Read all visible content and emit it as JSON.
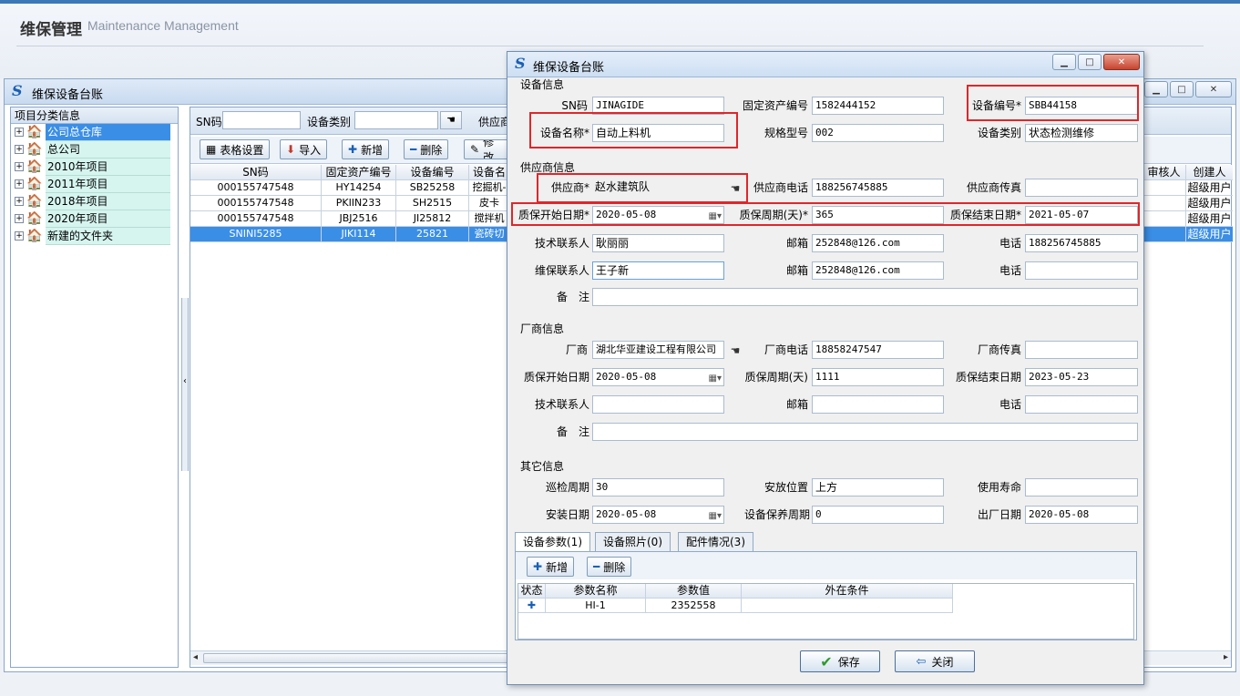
{
  "banner": {
    "title_cn": "维保管理",
    "title_en": "Maintenance Management"
  },
  "main_window": {
    "title": "维保设备台账",
    "tree": {
      "header": "项目分类信息",
      "items": [
        {
          "label": "公司总仓库",
          "selected": true
        },
        {
          "label": "总公司"
        },
        {
          "label": "2010年项目"
        },
        {
          "label": "2011年项目"
        },
        {
          "label": "2018年项目"
        },
        {
          "label": "2020年项目"
        },
        {
          "label": "新建的文件夹"
        }
      ]
    },
    "filter": {
      "sn_label": "SN码",
      "type_label": "设备类别",
      "supplier_label": "供应商"
    },
    "toolbar": {
      "table_settings": "表格设置",
      "import": "导入",
      "add": "新增",
      "delete": "删除",
      "edit": "修改"
    },
    "grid": {
      "headers": [
        "SN码",
        "固定资产编号",
        "设备编号",
        "设备名"
      ],
      "right_headers": [
        "审核人",
        "创建人"
      ],
      "rows": [
        {
          "sn": "000155747548",
          "asset": "HY14254",
          "code": "SB25258",
          "name": "挖掘机-",
          "creator": "超级用户"
        },
        {
          "sn": "000155747548",
          "asset": "PKIIN233",
          "code": "SH2515",
          "name": "皮卡",
          "creator": "超级用户"
        },
        {
          "sn": "000155747548",
          "asset": "JBJ2516",
          "code": "JI25812",
          "name": "搅拌机",
          "creator": "超级用户"
        },
        {
          "sn": "SNINI5285",
          "asset": "JIKI114",
          "code": "25821",
          "name": "瓷砖切",
          "creator": "超级用户",
          "selected": true
        }
      ]
    }
  },
  "dialog": {
    "title": "维保设备台账",
    "sections": {
      "device": "设备信息",
      "supplier": "供应商信息",
      "manufacturer": "厂商信息",
      "other": "其它信息"
    },
    "device": {
      "sn_label": "SN码",
      "sn_value": "JINAGIDE",
      "asset_label": "固定资产编号",
      "asset_value": "1582444152",
      "code_label": "设备编号*",
      "code_value": "SBB44158",
      "name_label": "设备名称*",
      "name_value": "自动上料机",
      "model_label": "规格型号",
      "model_value": "002",
      "type_label": "设备类别",
      "type_value": "状态检测维修"
    },
    "supplier": {
      "supplier_label": "供应商*",
      "supplier_value": "赵水建筑队",
      "phone_label": "供应商电话",
      "phone_value": "188256745885",
      "fax_label": "供应商传真",
      "fax_value": "",
      "wstart_label": "质保开始日期*",
      "wstart_value": "2020-05-08",
      "wperiod_label": "质保周期(天)*",
      "wperiod_value": "365",
      "wend_label": "质保结束日期*",
      "wend_value": "2021-05-07",
      "tech_label": "技术联系人",
      "tech_value": "耿丽丽",
      "email_label": "邮箱",
      "email_value": "252848@126.com",
      "tel_label": "电话",
      "tel_value": "188256745885",
      "maint_label": "维保联系人",
      "maint_value": "王子新",
      "email2_label": "邮箱",
      "email2_value": "252848@126.com",
      "tel2_label": "电话",
      "tel2_value": "",
      "remark_label": "备　注",
      "remark_value": ""
    },
    "manufacturer": {
      "name_label": "厂商",
      "name_value": "湖北华亚建设工程有限公司",
      "phone_label": "厂商电话",
      "phone_value": "18858247547",
      "fax_label": "厂商传真",
      "fax_value": "",
      "wstart_label": "质保开始日期",
      "wstart_value": "2020-05-08",
      "wperiod_label": "质保周期(天)",
      "wperiod_value": "1111",
      "wend_label": "质保结束日期",
      "wend_value": "2023-05-23",
      "tech_label": "技术联系人",
      "tech_value": "",
      "email_label": "邮箱",
      "email_value": "",
      "tel_label": "电话",
      "tel_value": "",
      "remark_label": "备　注",
      "remark_value": ""
    },
    "other": {
      "inspect_label": "巡检周期",
      "inspect_value": "30",
      "location_label": "安放位置",
      "location_value": "上方",
      "life_label": "使用寿命",
      "life_value": "",
      "install_label": "安装日期",
      "install_value": "2020-05-08",
      "maintcycle_label": "设备保养周期",
      "maintcycle_value": "0",
      "factory_label": "出厂日期",
      "factory_value": "2020-05-08"
    },
    "tabs": [
      "设备参数(1)",
      "设备照片(0)",
      "配件情况(3)"
    ],
    "params": {
      "add": "新增",
      "delete": "删除",
      "headers": [
        "状态",
        "参数名称",
        "参数值",
        "外在条件"
      ],
      "rows": [
        {
          "name": "HI-1",
          "value": "2352558",
          "cond": ""
        }
      ]
    },
    "buttons": {
      "save": "保存",
      "close": "关闭"
    }
  }
}
